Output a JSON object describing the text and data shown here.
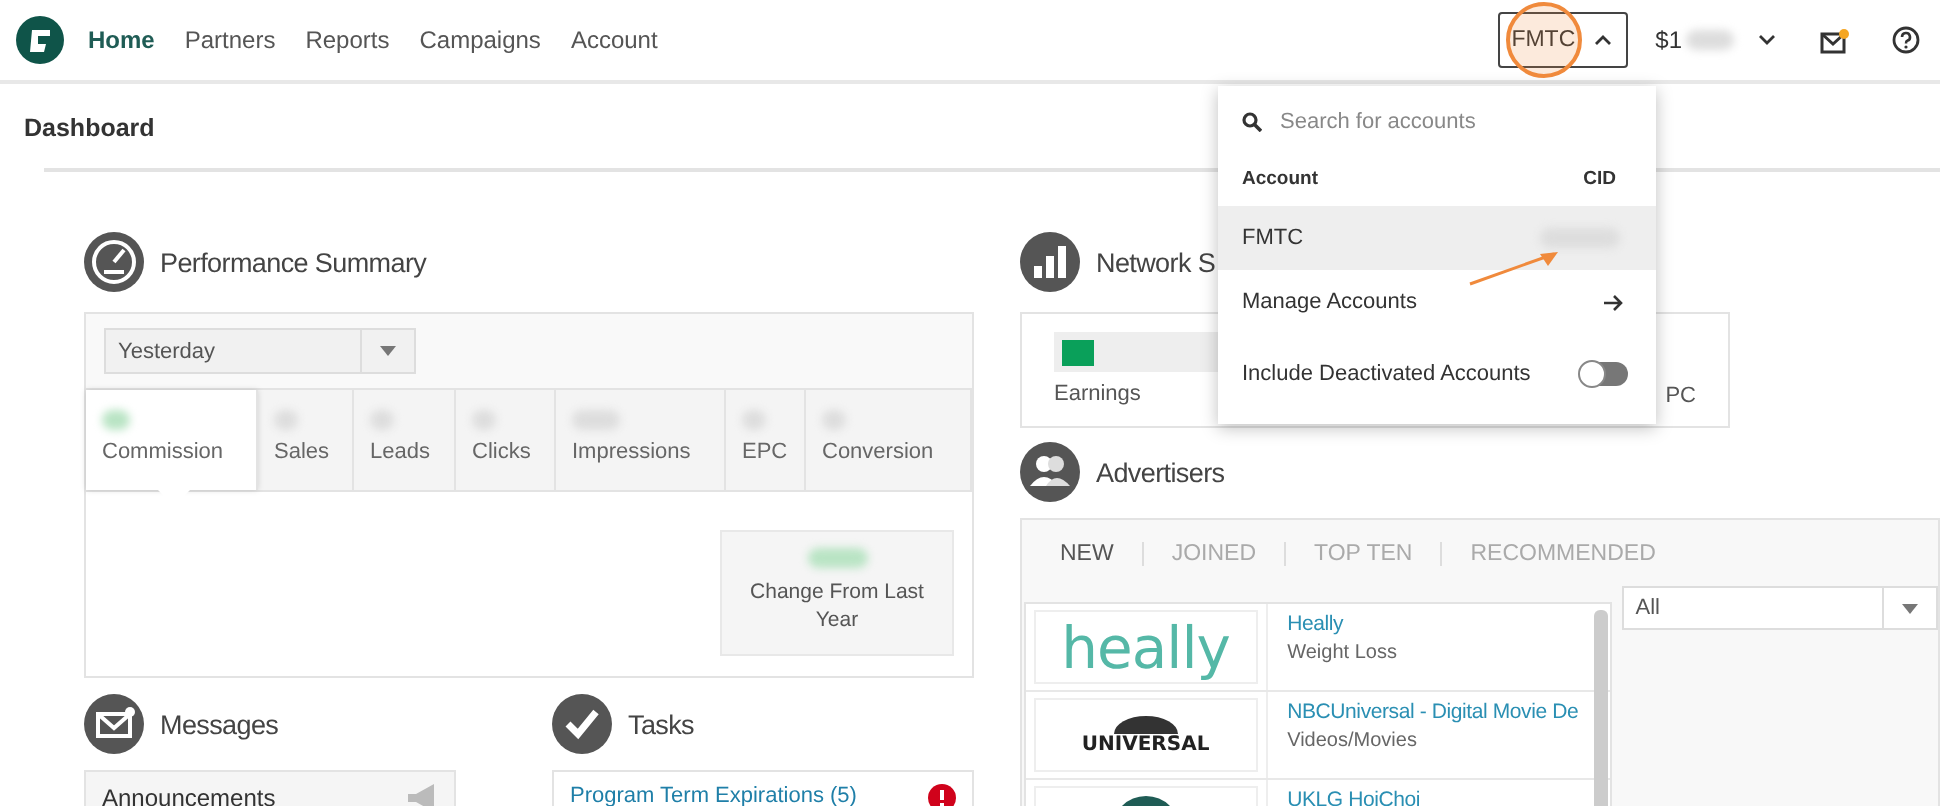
{
  "nav": {
    "items": [
      {
        "label": "Home",
        "selected": true
      },
      {
        "label": "Partners",
        "selected": false
      },
      {
        "label": "Reports",
        "selected": false
      },
      {
        "label": "Campaigns",
        "selected": false
      },
      {
        "label": "Account",
        "selected": false
      }
    ]
  },
  "account_button": {
    "label": "FMTC",
    "expanded": true
  },
  "balance": {
    "label": "$1"
  },
  "notifications": {
    "unread": true
  },
  "page_title": "Dashboard",
  "performance_summary": {
    "title": "Performance Summary",
    "period": "Yesterday",
    "metrics": [
      {
        "label": "Commission",
        "selected": true
      },
      {
        "label": "Sales",
        "selected": false
      },
      {
        "label": "Leads",
        "selected": false
      },
      {
        "label": "Clicks",
        "selected": false
      },
      {
        "label": "Impressions",
        "selected": false
      },
      {
        "label": "EPC",
        "selected": false
      },
      {
        "label": "Conversion",
        "selected": false
      }
    ],
    "change_label": "Change From Last Year"
  },
  "messages": {
    "title": "Messages",
    "announcements": "Announcements"
  },
  "tasks": {
    "title": "Tasks",
    "items": [
      {
        "label": "Program Term Expirations (5)",
        "alert": true
      }
    ]
  },
  "network": {
    "title": "Network S",
    "metrics": [
      {
        "label": "Earnings",
        "kind": "bar"
      },
      {
        "label": "PC",
        "kind": "plain"
      }
    ]
  },
  "advertisers": {
    "title": "Advertisers",
    "tabs": [
      {
        "label": "NEW",
        "selected": true
      },
      {
        "label": "JOINED",
        "selected": false
      },
      {
        "label": "TOP TEN",
        "selected": false
      },
      {
        "label": "RECOMMENDED",
        "selected": false
      }
    ],
    "filter": "All",
    "rows": [
      {
        "name": "Heally",
        "category": "Weight Loss",
        "logo": {
          "kind": "script",
          "text": "heally"
        }
      },
      {
        "name": "NBCUniversal - Digital Movie De",
        "category": "Videos/Movies",
        "logo": {
          "kind": "globe",
          "text": "UNIVERSAL"
        }
      },
      {
        "name": "UKLG HoiChoi",
        "logo": {
          "kind": "emblem"
        }
      }
    ]
  },
  "account_menu": {
    "search_placeholder": "Search for accounts",
    "columns": [
      "Account",
      "CID"
    ],
    "accounts": [
      {
        "name": "FMTC",
        "selected": true
      }
    ],
    "manage_label": "Manage Accounts",
    "include_deactivated": {
      "label": "Include Deactivated Accounts",
      "on": false
    }
  }
}
